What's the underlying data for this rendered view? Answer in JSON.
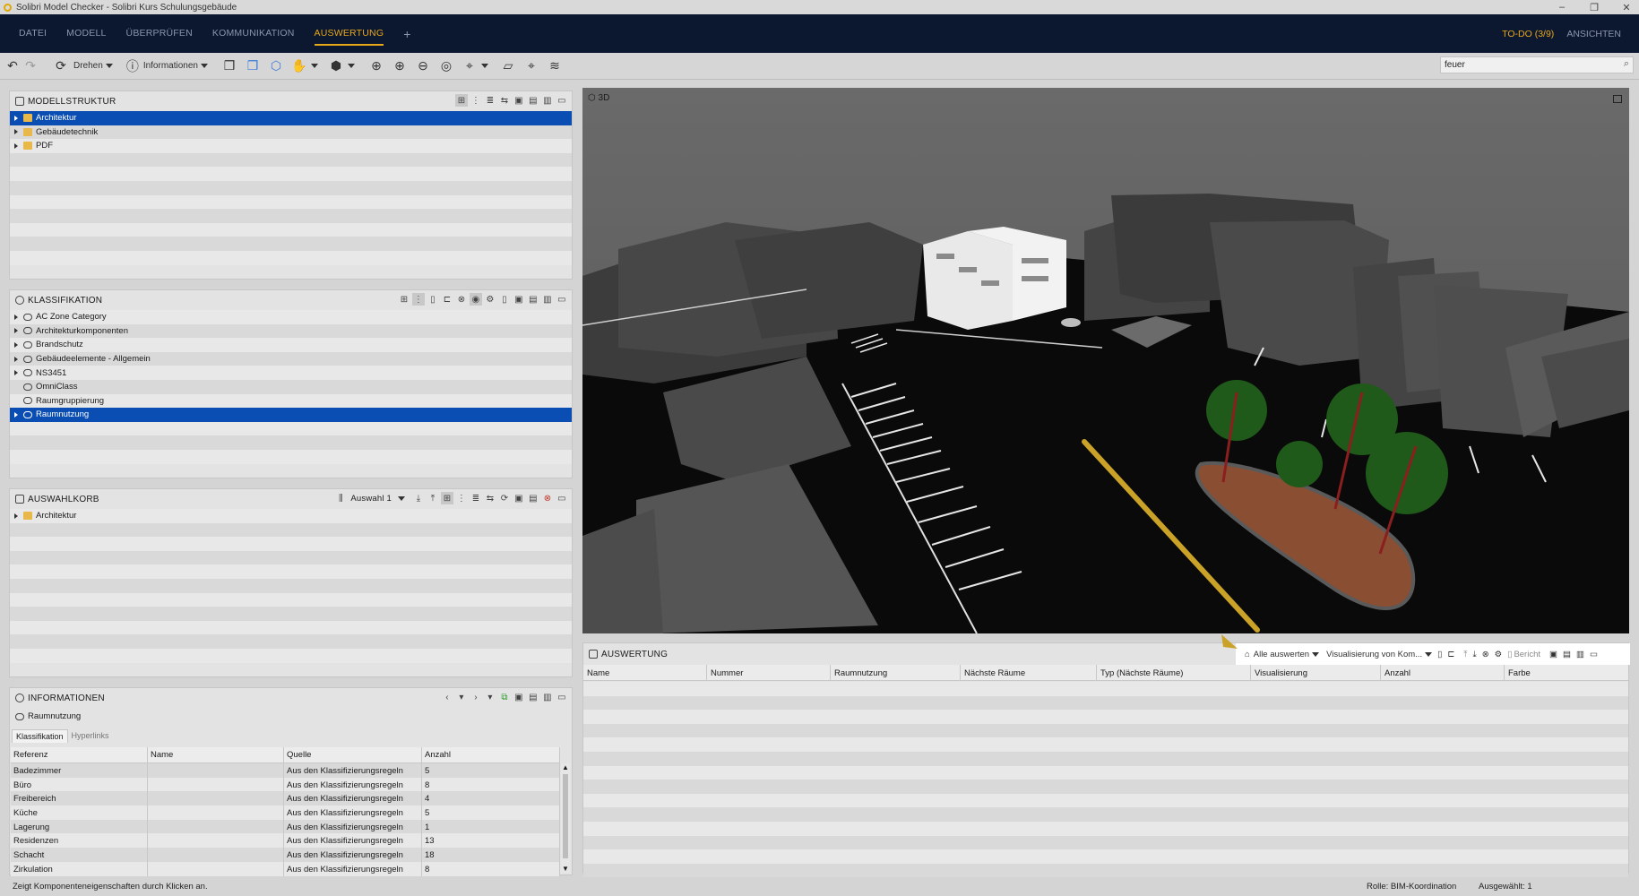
{
  "window": {
    "title": "Solibri Model Checker - Solibri Kurs Schulungsgebäude",
    "controls": [
      "–",
      "❐",
      "✕"
    ]
  },
  "menu": {
    "items": [
      "DATEI",
      "MODELL",
      "ÜBERPRÜFEN",
      "KOMMUNIKATION",
      "AUSWERTUNG"
    ],
    "active": "AUSWERTUNG",
    "plus": "+",
    "todo": "TO-DO (3/9)",
    "views": "ANSICHTEN"
  },
  "toolbar": {
    "rotate_label": "Drehen",
    "info_label": "Informationen",
    "search_value": "feuer"
  },
  "modellstruktur": {
    "title": "MODELLSTRUKTUR",
    "items": [
      {
        "label": "Architektur",
        "selected": true
      },
      {
        "label": "Gebäudetechnik",
        "selected": false
      },
      {
        "label": "PDF",
        "selected": false
      }
    ]
  },
  "klassifikation": {
    "title": "KLASSIFIKATION",
    "items": [
      {
        "label": "AC Zone Category",
        "expandable": true,
        "selected": false
      },
      {
        "label": "Architekturkomponenten",
        "expandable": true,
        "selected": false
      },
      {
        "label": "Brandschutz",
        "expandable": true,
        "selected": false
      },
      {
        "label": "Gebäudeelemente - Allgemein",
        "expandable": true,
        "selected": false
      },
      {
        "label": "NS3451",
        "expandable": true,
        "selected": false
      },
      {
        "label": "OmniClass",
        "expandable": false,
        "selected": false
      },
      {
        "label": "Raumgruppierung",
        "expandable": false,
        "selected": false
      },
      {
        "label": "Raumnutzung",
        "expandable": true,
        "selected": true
      }
    ]
  },
  "auswahlkorb": {
    "title": "AUSWAHLKORB",
    "selection_label": "Auswahl 1",
    "items": [
      {
        "label": "Architektur"
      }
    ]
  },
  "informationen": {
    "title": "INFORMATIONEN",
    "subject": "Raumnutzung",
    "tabs": [
      "Klassifikation",
      "Hyperlinks"
    ],
    "active_tab": "Klassifikation",
    "columns": [
      "Referenz",
      "Name",
      "Quelle",
      "Anzahl"
    ],
    "rows": [
      [
        "Badezimmer",
        "",
        "Aus den Klassifizierungsregeln",
        "5"
      ],
      [
        "Büro",
        "",
        "Aus den Klassifizierungsregeln",
        "8"
      ],
      [
        "Freibereich",
        "",
        "Aus den Klassifizierungsregeln",
        "4"
      ],
      [
        "Küche",
        "",
        "Aus den Klassifizierungsregeln",
        "5"
      ],
      [
        "Lagerung",
        "",
        "Aus den Klassifizierungsregeln",
        "1"
      ],
      [
        "Residenzen",
        "",
        "Aus den Klassifizierungsregeln",
        "13"
      ],
      [
        "Schacht",
        "",
        "Aus den Klassifizierungsregeln",
        "18"
      ],
      [
        "Zirkulation",
        "",
        "Aus den Klassifizierungsregeln",
        "8"
      ]
    ]
  },
  "view3d": {
    "title": "3D"
  },
  "auswertung": {
    "title": "AUSWERTUNG",
    "all_label": "Alle auswerten",
    "vis_label": "Visualisierung von Kom...",
    "report_label": "Bericht",
    "columns": [
      "Name",
      "Nummer",
      "Raumnutzung",
      "Nächste Räume",
      "Typ (Nächste Räume)",
      "Visualisierung",
      "Anzahl",
      "Farbe"
    ]
  },
  "status": {
    "hint": "Zeigt Komponenteneigenschaften durch Klicken an.",
    "role": "Rolle: BIM-Koordination",
    "selected": "Ausgewählt: 1"
  },
  "colors": {
    "menu_bg": "#0c1730",
    "accent": "#e8a818",
    "selection": "#0a4db3",
    "arrow": "#c9a227"
  }
}
